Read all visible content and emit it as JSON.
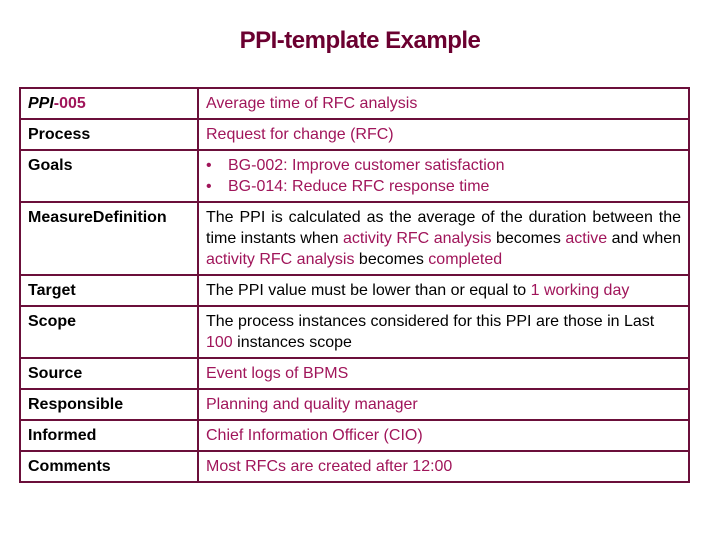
{
  "title": "PPI-template Example",
  "colors": {
    "title": "#6b0030",
    "border": "#6b0f3a",
    "highlight": "#a0155a",
    "label": "#000000"
  },
  "rows": {
    "id": {
      "label_prefix": "PPI",
      "label_suffix": "-005",
      "value": "Average time of RFC analysis"
    },
    "process": {
      "label": "Process",
      "value": "Request for change (RFC)"
    },
    "goals": {
      "label": "Goals",
      "bullet": "•",
      "items": [
        "BG-002: Improve customer satisfaction",
        "BG-014: Reduce RFC response time"
      ]
    },
    "measure_definition": {
      "label": "MeasureDefinition",
      "segments": [
        {
          "text": "The PPI is calculated as the average of the duration between the time instants when ",
          "highlight": false
        },
        {
          "text": "activity RFC analysis",
          "highlight": true
        },
        {
          "text": " becomes  ",
          "highlight": false
        },
        {
          "text": "active",
          "highlight": true
        },
        {
          "text": " and when ",
          "highlight": false
        },
        {
          "text": "activity RFC analysis",
          "highlight": true
        },
        {
          "text": " becomes ",
          "highlight": false
        },
        {
          "text": "completed",
          "highlight": true
        }
      ]
    },
    "target": {
      "label": "Target",
      "text_before": "The PPI value must be lower than or equal to ",
      "highlight": "1 working day"
    },
    "scope": {
      "label": "Scope",
      "text_before": "The process instances considered for this PPI are those in Last  ",
      "highlight": "100",
      "text_after": " instances scope"
    },
    "source": {
      "label": "Source",
      "value": "Event logs of BPMS"
    },
    "responsible": {
      "label": "Responsible",
      "value": "Planning and quality manager"
    },
    "informed": {
      "label": "Informed",
      "value": "Chief Information Officer (CIO)"
    },
    "comments": {
      "label": "Comments",
      "value": "Most RFCs are created after 12:00"
    }
  }
}
